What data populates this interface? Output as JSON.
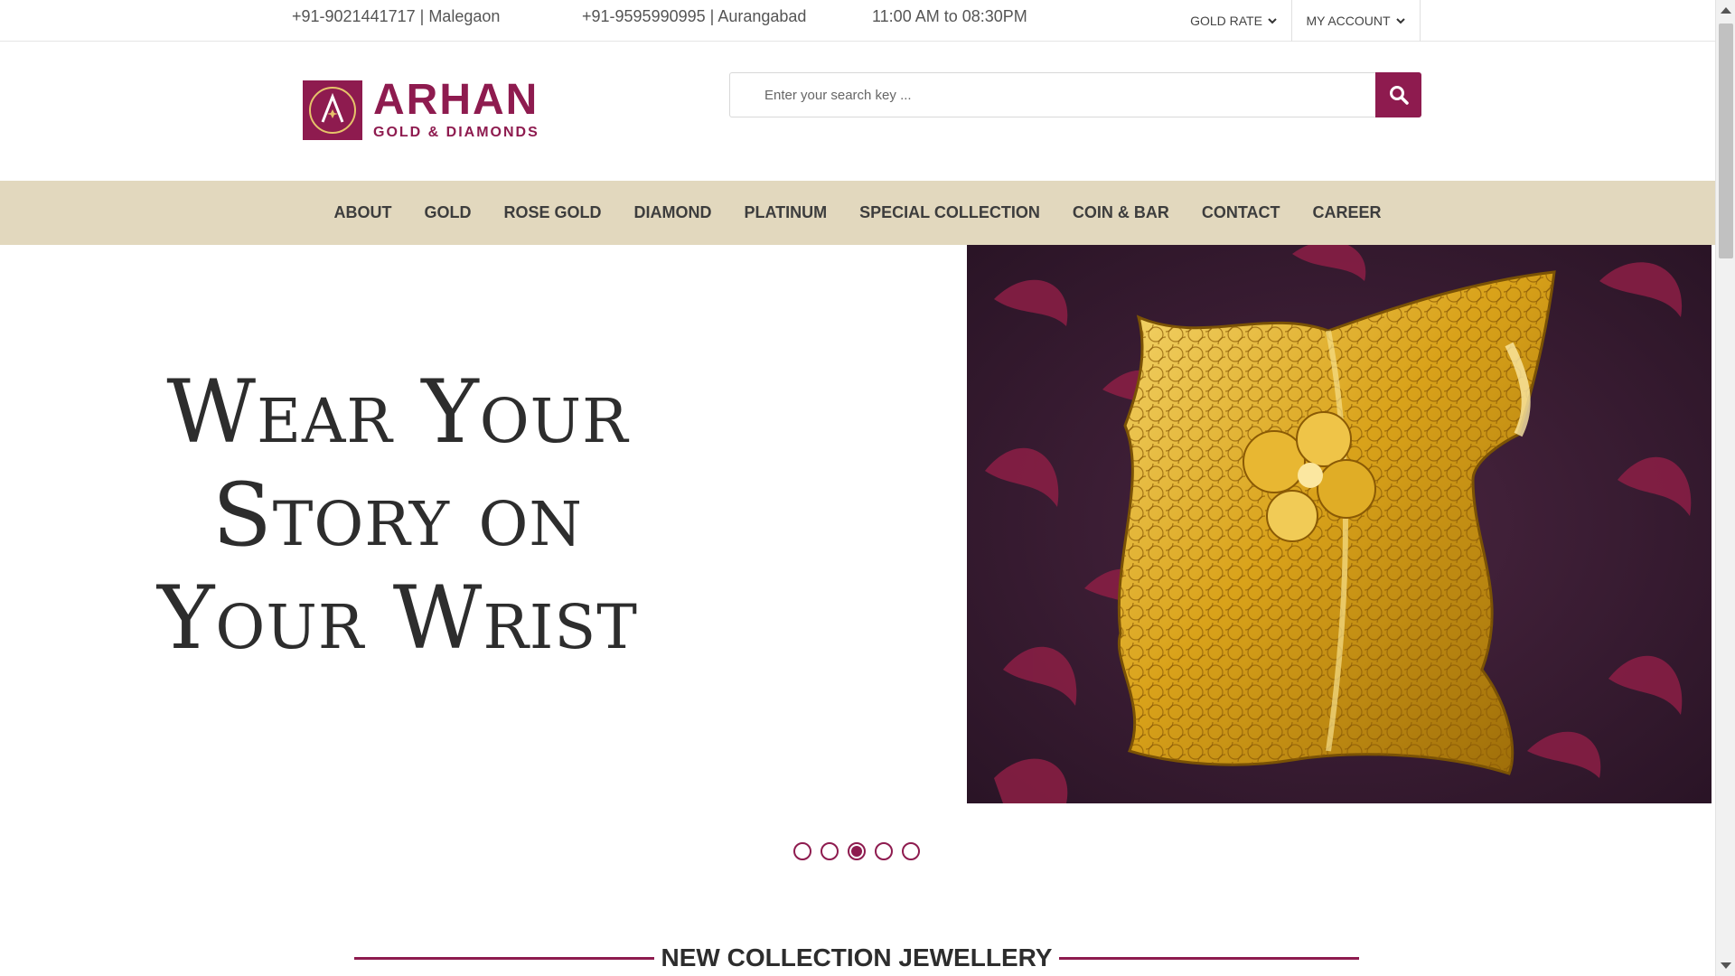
{
  "topbar": {
    "contact1": "+91-9021441717 | Malegaon",
    "contact2": "+91-9595990995 | Aurangabad",
    "hours": "11:00 AM to 08:30PM",
    "gold_rate": "GOLD RATE",
    "my_account": "MY ACCOUNT"
  },
  "logo": {
    "brand": "ARHAN",
    "sub": "GOLD & DIAMONDS"
  },
  "search": {
    "placeholder": "Enter your search key ...",
    "icon": "search-icon"
  },
  "nav": {
    "items": [
      "ABOUT",
      "GOLD",
      "ROSE GOLD",
      "DIAMOND",
      "PLATINUM",
      "SPECIAL COLLECTION",
      "COIN & BAR",
      "CONTACT",
      "CAREER"
    ]
  },
  "hero": {
    "line1": "Wear Your",
    "line2": "Story on",
    "line3": "Your Wrist",
    "slide_count": 5,
    "active_slide": 3
  },
  "section": {
    "title": "NEW COLLECTION JEWELLERY"
  },
  "colors": {
    "brand": "#8e1b4f",
    "nav_bg": "#e2d8be",
    "gold": "#d4a017"
  }
}
